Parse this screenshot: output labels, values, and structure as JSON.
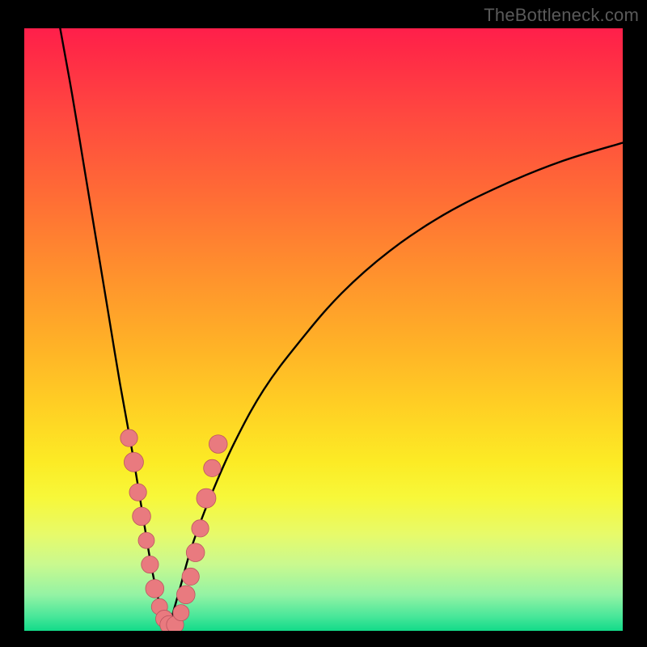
{
  "watermark": "TheBottleneck.com",
  "colors": {
    "background": "#000000",
    "gradient_top": "#ff1f4b",
    "gradient_mid_upper": "#ff8c2e",
    "gradient_mid_lower": "#fceb25",
    "gradient_bottom": "#12db89",
    "curve": "#000000",
    "dot_fill": "#e97a7f",
    "dot_stroke": "#bb5560"
  },
  "chart_data": {
    "type": "line",
    "title": "",
    "xlabel": "",
    "ylabel": "",
    "xlim": [
      0,
      100
    ],
    "ylim": [
      0,
      100
    ],
    "grid": false,
    "legend": false,
    "description": "V-shaped bottleneck curve on a green-to-red gradient. The vertical axis represents bottleneck severity (0 near bottom/green = no bottleneck, 100 near top/red = severe). The curve falls steeply from the upper-left, reaches zero around x≈24, then rises with diminishing slope toward the right edge. Salmon dots mark sampled configurations clustered near the minimum.",
    "series": [
      {
        "name": "left-branch",
        "x": [
          6,
          8,
          10,
          12,
          14,
          16,
          18,
          20,
          21,
          22,
          23,
          24
        ],
        "y": [
          100,
          89,
          77,
          65,
          53,
          41,
          30,
          18,
          12,
          7,
          3,
          0
        ]
      },
      {
        "name": "right-branch",
        "x": [
          24,
          26,
          28,
          31,
          35,
          40,
          46,
          53,
          61,
          70,
          80,
          90,
          100
        ],
        "y": [
          0,
          7,
          14,
          22,
          31,
          40,
          48,
          56,
          63,
          69,
          74,
          78,
          81
        ]
      }
    ],
    "dots": [
      {
        "x": 17.5,
        "y": 32,
        "r": 1.0
      },
      {
        "x": 18.3,
        "y": 28,
        "r": 1.2
      },
      {
        "x": 19.0,
        "y": 23,
        "r": 1.0
      },
      {
        "x": 19.6,
        "y": 19,
        "r": 1.1
      },
      {
        "x": 20.4,
        "y": 15,
        "r": 0.9
      },
      {
        "x": 21.0,
        "y": 11,
        "r": 1.0
      },
      {
        "x": 21.8,
        "y": 7,
        "r": 1.1
      },
      {
        "x": 22.6,
        "y": 4,
        "r": 0.9
      },
      {
        "x": 23.4,
        "y": 2,
        "r": 1.0
      },
      {
        "x": 24.2,
        "y": 1,
        "r": 1.1
      },
      {
        "x": 25.2,
        "y": 1,
        "r": 1.0
      },
      {
        "x": 26.2,
        "y": 3,
        "r": 0.9
      },
      {
        "x": 27.0,
        "y": 6,
        "r": 1.1
      },
      {
        "x": 27.8,
        "y": 9,
        "r": 1.0
      },
      {
        "x": 28.6,
        "y": 13,
        "r": 1.1
      },
      {
        "x": 29.4,
        "y": 17,
        "r": 1.0
      },
      {
        "x": 30.4,
        "y": 22,
        "r": 1.2
      },
      {
        "x": 31.4,
        "y": 27,
        "r": 1.0
      },
      {
        "x": 32.4,
        "y": 31,
        "r": 1.1
      }
    ]
  }
}
